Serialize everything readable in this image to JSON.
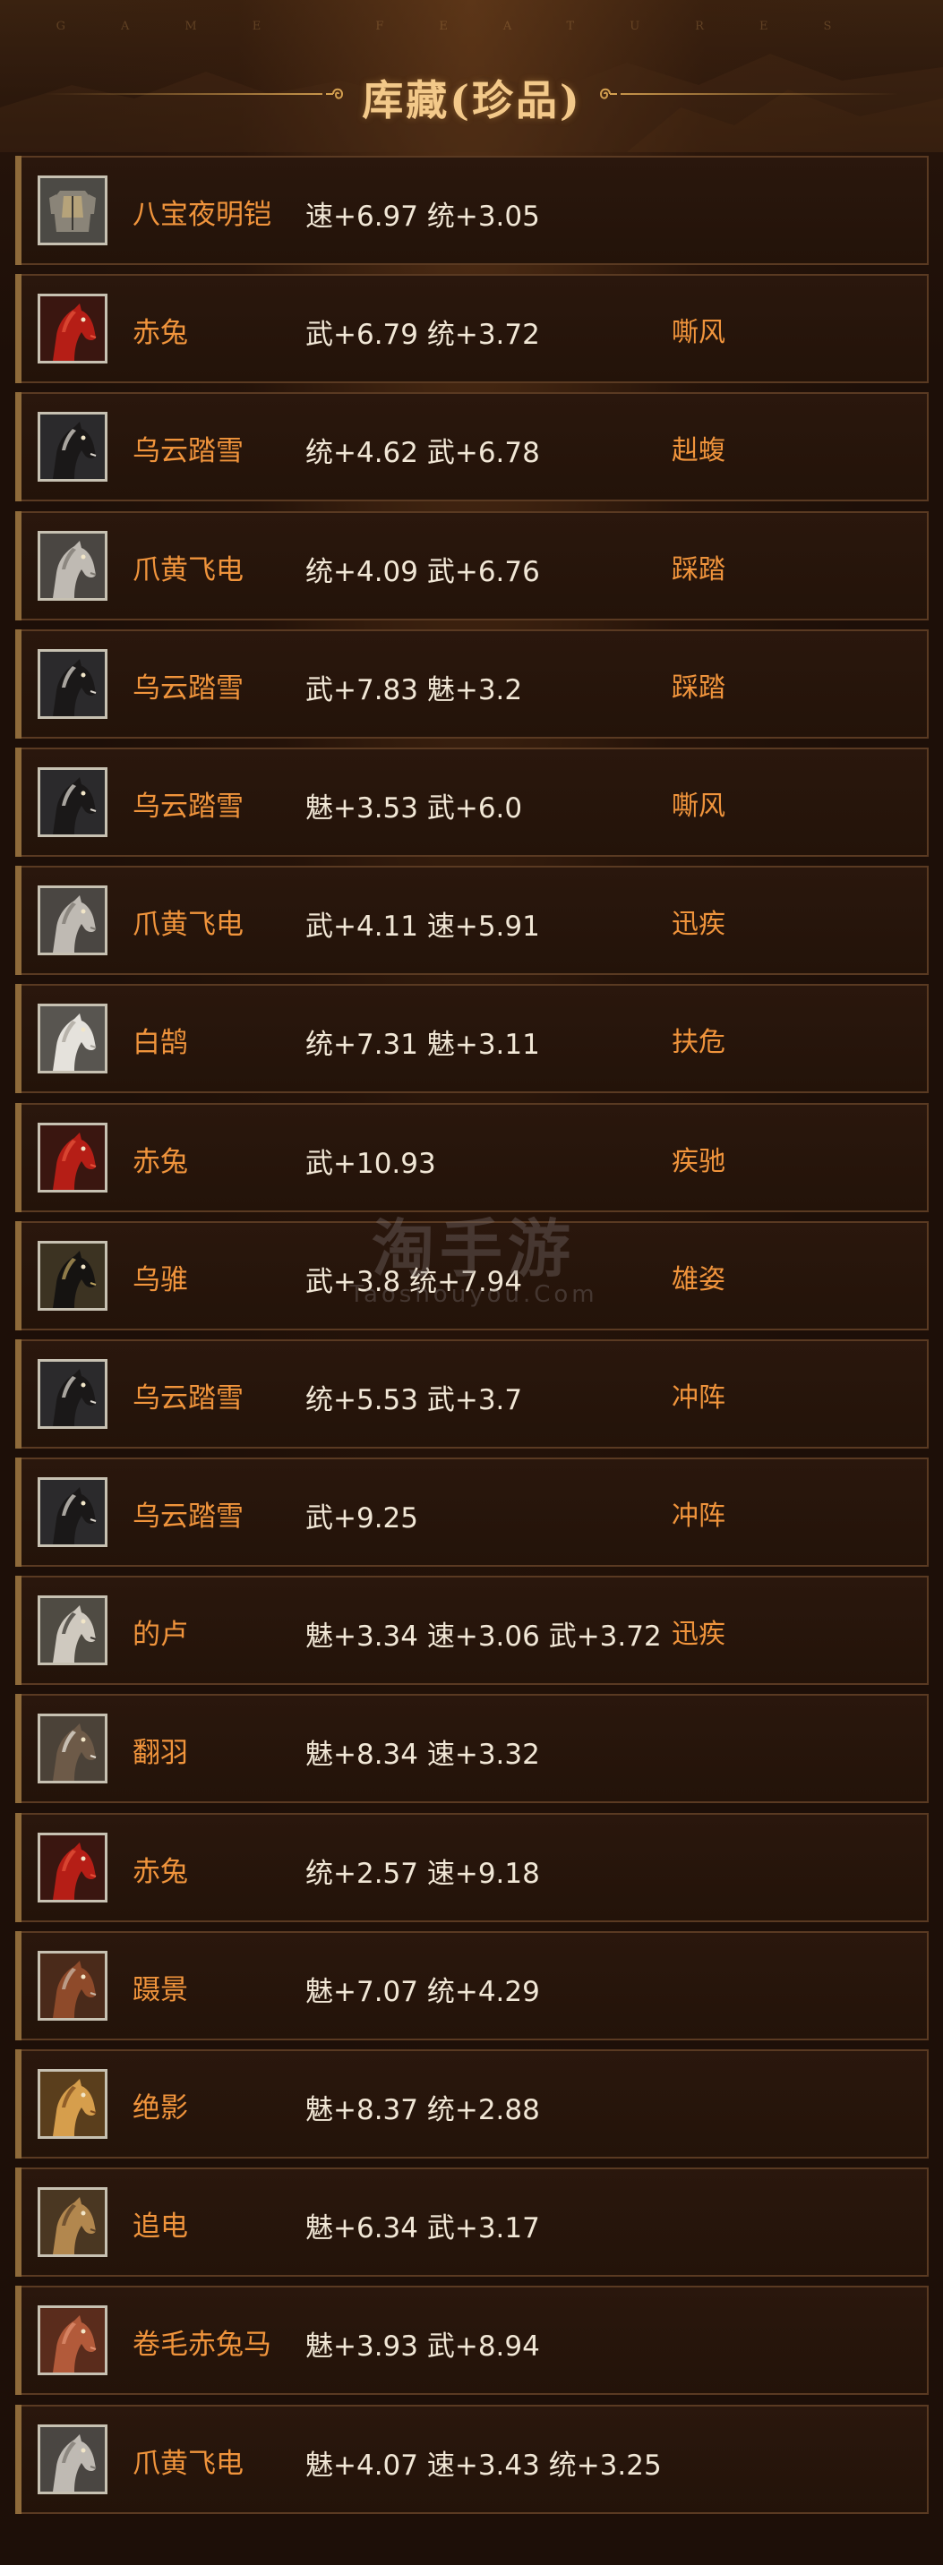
{
  "header": {
    "subtitle": "GAME FEATURES",
    "title": "库藏(珍品)"
  },
  "watermark": {
    "cn": "淘手游",
    "en": "Taoshouyou.Com"
  },
  "items": [
    {
      "name": "八宝夜明铠",
      "stats": "速+6.97 统+3.05",
      "skill": "",
      "icon": "armor-icon"
    },
    {
      "name": "赤兔",
      "stats": "武+6.79 统+3.72",
      "skill": "嘶风",
      "icon": "red-horse-icon"
    },
    {
      "name": "乌云踏雪",
      "stats": "统+4.62 武+6.78",
      "skill": "赳蝮",
      "icon": "black-horse-icon"
    },
    {
      "name": "爪黄飞电",
      "stats": "统+4.09 武+6.76",
      "skill": "踩踏",
      "icon": "armored-horse-icon"
    },
    {
      "name": "乌云踏雪",
      "stats": "武+7.83 魅+3.2",
      "skill": "踩踏",
      "icon": "black-horse-icon"
    },
    {
      "name": "乌云踏雪",
      "stats": "魅+3.53 武+6.0",
      "skill": "嘶风",
      "icon": "black-horse-icon"
    },
    {
      "name": "爪黄飞电",
      "stats": "武+4.11 速+5.91",
      "skill": "迅疾",
      "icon": "armored-horse-icon"
    },
    {
      "name": "白鹄",
      "stats": "统+7.31 魅+3.11",
      "skill": "扶危",
      "icon": "white-horse-icon"
    },
    {
      "name": "赤兔",
      "stats": "武+10.93",
      "skill": "疾驰",
      "icon": "red-horse-icon"
    },
    {
      "name": "乌骓",
      "stats": "武+3.8 统+7.94",
      "skill": "雄姿",
      "icon": "dark-horse-icon"
    },
    {
      "name": "乌云踏雪",
      "stats": "统+5.53 武+3.7",
      "skill": "冲阵",
      "icon": "black-horse-icon"
    },
    {
      "name": "乌云踏雪",
      "stats": "武+9.25",
      "skill": "冲阵",
      "icon": "black-horse-icon"
    },
    {
      "name": "的卢",
      "stats": "魅+3.34 速+3.06 武+3.72",
      "skill": "迅疾",
      "icon": "grey-horse-icon"
    },
    {
      "name": "翻羽",
      "stats": "魅+8.34 速+3.32",
      "skill": "",
      "icon": "feather-horse-icon"
    },
    {
      "name": "赤兔",
      "stats": "统+2.57 速+9.18",
      "skill": "",
      "icon": "red-horse-icon"
    },
    {
      "name": "蹑景",
      "stats": "魅+7.07 统+4.29",
      "skill": "",
      "icon": "brown-horse-icon"
    },
    {
      "name": "绝影",
      "stats": "魅+8.37 统+2.88",
      "skill": "",
      "icon": "golden-horse-icon"
    },
    {
      "name": "追电",
      "stats": "魅+6.34 武+3.17",
      "skill": "",
      "icon": "tan-horse-icon"
    },
    {
      "name": "卷毛赤兔马",
      "stats": "魅+3.93 武+8.94",
      "skill": "",
      "icon": "curly-red-horse-icon"
    },
    {
      "name": "爪黄飞电",
      "stats": "魅+4.07 速+3.43 统+3.25",
      "skill": "",
      "icon": "armored-horse-icon"
    }
  ]
}
